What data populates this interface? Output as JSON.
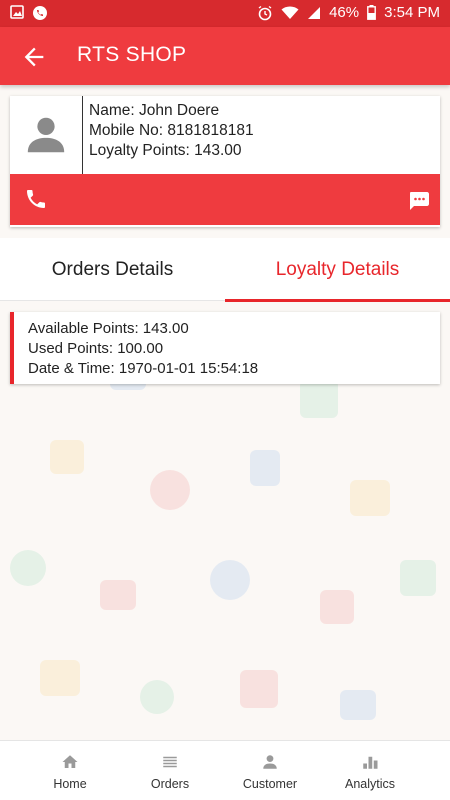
{
  "statusbar": {
    "battery": "46%",
    "time": "3:54 PM"
  },
  "appbar": {
    "title": "RTS SHOP",
    "back_icon": "arrow-back-icon"
  },
  "customer": {
    "name": "Name: John Doere",
    "mobile": "Mobile No: 8181818181",
    "loyalty_points": "Loyalty Points: 143.00",
    "avatar_icon": "person-icon",
    "call_icon": "phone-icon",
    "message_icon": "chat-icon"
  },
  "tabs": [
    {
      "label": "Orders Details",
      "active": false
    },
    {
      "label": "Loyalty Details",
      "active": true
    }
  ],
  "loyalty": {
    "available": "Available Points: 143.00",
    "used": "Used Points: 100.00",
    "datetime": "Date & Time: 1970-01-01 15:54:18"
  },
  "bottom_nav": [
    {
      "label": "Home",
      "icon": "home-icon"
    },
    {
      "label": "Orders",
      "icon": "list-icon"
    },
    {
      "label": "Customer",
      "icon": "person-icon"
    },
    {
      "label": "Analytics",
      "icon": "bar-chart-icon"
    }
  ],
  "colors": {
    "primary": "#ef3b3f",
    "statusbar": "#d72a2e",
    "accent": "#e8262b"
  }
}
